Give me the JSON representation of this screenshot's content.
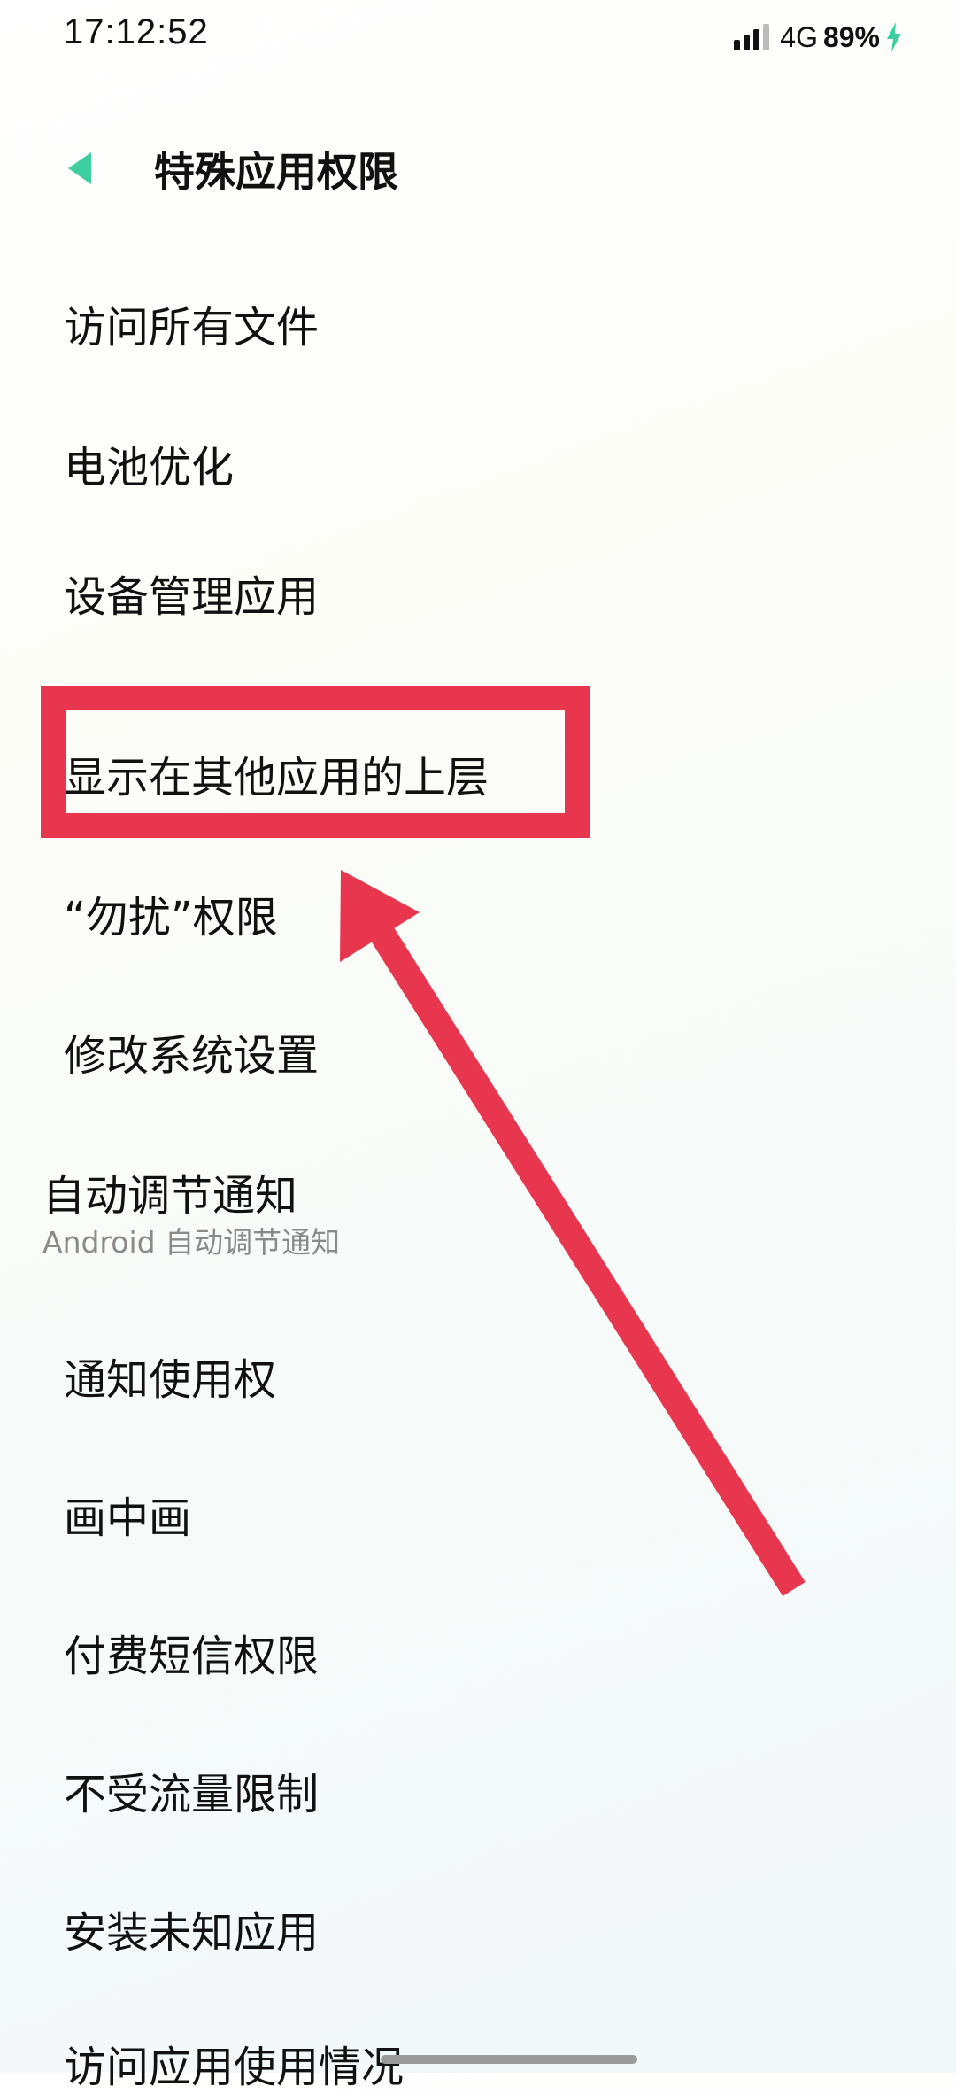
{
  "status_bar": {
    "time": "17:12:52",
    "network": "4G",
    "battery": "89%",
    "icons": [
      "signal-icon",
      "charging-icon"
    ]
  },
  "header": {
    "title": "特殊应用权限",
    "back_icon": "back-arrow-icon",
    "accent_color": "#3ecfa0"
  },
  "menu": {
    "items": [
      {
        "label": "访问所有文件"
      },
      {
        "label": "电池优化"
      },
      {
        "label": "设备管理应用"
      },
      {
        "label": "显示在其他应用的上层"
      },
      {
        "label": "“勿扰”权限"
      },
      {
        "label": "修改系统设置"
      },
      {
        "label": "自动调节通知",
        "subtitle": "Android 自动调节通知"
      },
      {
        "label": "通知使用权"
      },
      {
        "label": "画中画"
      },
      {
        "label": "付费短信权限"
      },
      {
        "label": "不受流量限制"
      },
      {
        "label": "安装未知应用"
      },
      {
        "label": "访问应用使用情况"
      }
    ]
  },
  "annotation": {
    "color": "#e8364e",
    "highlighted_item": "显示在其他应用的上层"
  }
}
